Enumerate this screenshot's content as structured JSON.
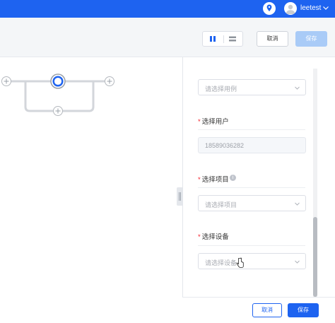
{
  "header": {
    "username": "leetest",
    "colors": {
      "bar": "#1e63f0"
    },
    "icons": [
      "location-pin-icon",
      "user-avatar-icon",
      "chevron-down-icon"
    ]
  },
  "toolbar": {
    "view_toggle": [
      "columns-view-icon",
      "rows-view-icon"
    ],
    "cancel_label": "取消",
    "save_label": "保存"
  },
  "form": {
    "use_case": {
      "placeholder": "请选择用例"
    },
    "user": {
      "label": "选择用户",
      "required": true,
      "value": "18589036282"
    },
    "project": {
      "label": "选择项目",
      "required": true,
      "placeholder": "请选择项目"
    },
    "device": {
      "label": "选择设备",
      "required": true,
      "placeholder": "请选择设备"
    }
  },
  "footer": {
    "cancel_label": "取消",
    "save_label": "保存"
  }
}
